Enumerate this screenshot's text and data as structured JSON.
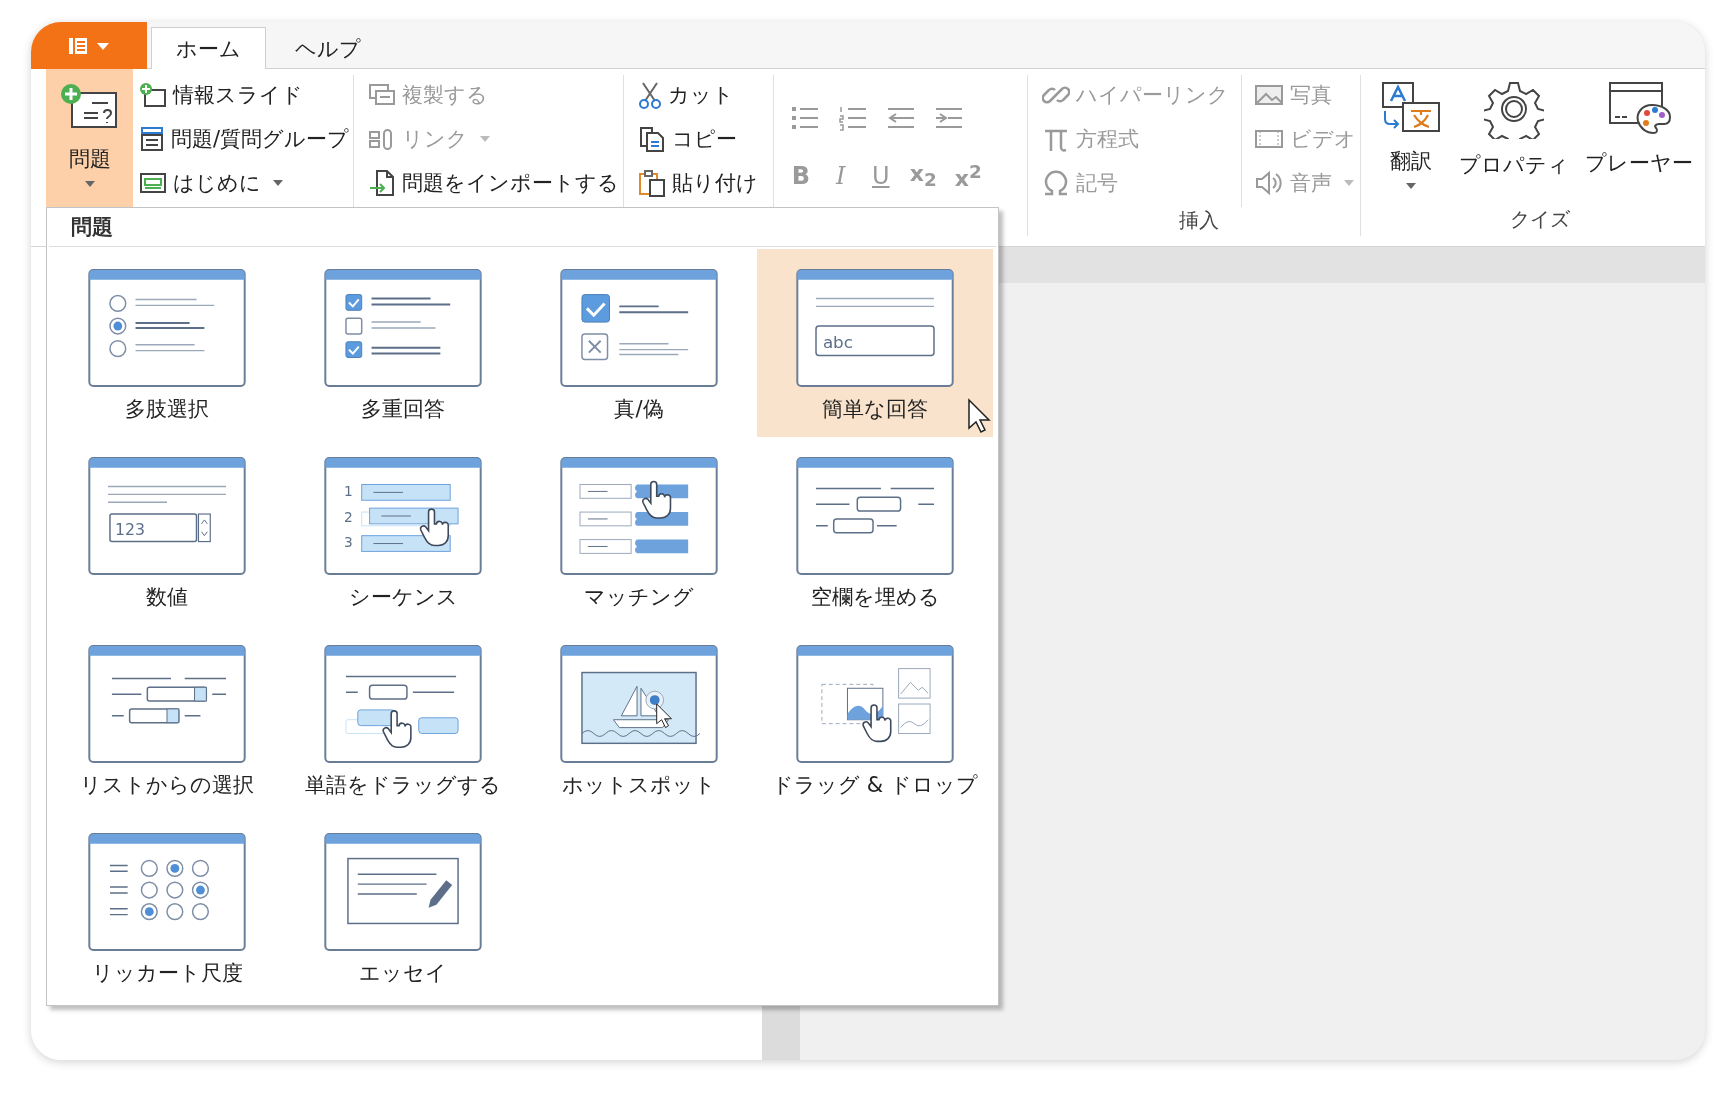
{
  "tabs": [
    {
      "label": "ホーム",
      "selected": true
    },
    {
      "label": "ヘルプ",
      "selected": false
    }
  ],
  "ribbon": {
    "groups": [
      {
        "kind": "columns",
        "columns": [
          [
            {
              "kind": "large",
              "label": "問題",
              "pressed": true,
              "dropdown": true
            }
          ],
          [
            {
              "kind": "small",
              "label": "情報スライド",
              "dropdown": false,
              "disabled": false
            },
            {
              "kind": "small",
              "label": "問題/質問グループ",
              "dropdown": false,
              "disabled": false
            },
            {
              "kind": "small",
              "label": "はじめに",
              "dropdown": true,
              "disabled": false
            }
          ]
        ]
      },
      {
        "kind": "columns",
        "columns": [
          [
            {
              "kind": "small",
              "label": "複製する",
              "dropdown": false,
              "disabled": true
            },
            {
              "kind": "small",
              "label": "リンク",
              "dropdown": true,
              "disabled": true
            },
            {
              "kind": "small",
              "label": "問題をインポートする",
              "dropdown": false,
              "disabled": false
            }
          ]
        ]
      },
      {
        "kind": "columns",
        "columns": [
          [
            {
              "kind": "small",
              "label": "カット",
              "dropdown": false,
              "disabled": false
            },
            {
              "kind": "small",
              "label": "コピー",
              "dropdown": false,
              "disabled": false
            },
            {
              "kind": "small",
              "label": "貼り付け",
              "dropdown": false,
              "disabled": false
            }
          ]
        ]
      },
      {
        "kind": "rows",
        "rows": [
          [
            {
              "kind": "tool",
              "disabled": true
            },
            {
              "kind": "tool",
              "disabled": true
            },
            {
              "kind": "tool",
              "disabled": true
            },
            {
              "kind": "tool",
              "disabled": true
            }
          ],
          [
            {
              "kind": "format",
              "label": "B",
              "disabled": true
            },
            {
              "kind": "format",
              "label": "I",
              "disabled": true
            },
            {
              "kind": "format",
              "label": "U",
              "disabled": true
            },
            {
              "kind": "format",
              "label": "x$_{2}$",
              "disabled": true
            },
            {
              "kind": "format",
              "label": "x$^{2}$",
              "disabled": true
            }
          ]
        ]
      },
      {
        "kind": "columns",
        "label": "挿入",
        "columns": [
          [
            {
              "kind": "small",
              "label": "ハイパーリンク",
              "dropdown": false,
              "disabled": true
            },
            {
              "kind": "small",
              "label": "方程式",
              "dropdown": false,
              "disabled": true
            },
            {
              "kind": "small",
              "label": "記号",
              "dropdown": false,
              "disabled": true
            }
          ],
          [
            {
              "kind": "small",
              "label": "写真",
              "dropdown": false,
              "disabled": true
            },
            {
              "kind": "small",
              "label": "ビデオ",
              "dropdown": false,
              "disabled": true
            },
            {
              "kind": "small",
              "label": "音声",
              "dropdown": true,
              "disabled": true
            }
          ]
        ]
      },
      {
        "kind": "columns",
        "label": "クイズ",
        "columns": [
          [
            {
              "kind": "large",
              "label": "翻訳",
              "pressed": false,
              "dropdown": true
            }
          ],
          [
            {
              "kind": "large",
              "label": "プロパティ",
              "pressed": false,
              "dropdown": false
            }
          ],
          [
            {
              "kind": "large",
              "label": "プレーヤー",
              "pressed": false,
              "dropdown": false
            }
          ]
        ]
      }
    ]
  },
  "gallery": {
    "title": "問題",
    "items": [
      {
        "label": "多肢選択",
        "selected": false
      },
      {
        "label": "多重回答",
        "selected": false
      },
      {
        "label": "真/偽",
        "selected": false
      },
      {
        "label": "簡単な回答",
        "selected": true,
        "icon_texts": [
          "abc"
        ]
      },
      {
        "label": "数値",
        "selected": false,
        "icon_texts": [
          "123"
        ]
      },
      {
        "label": "シーケンス",
        "selected": false,
        "icon_texts": [
          "1",
          "2",
          "3"
        ]
      },
      {
        "label": "マッチング",
        "selected": false
      },
      {
        "label": "空欄を埋める",
        "selected": false
      },
      {
        "label": "リストからの選択",
        "selected": false
      },
      {
        "label": "単語をドラッグする",
        "selected": false
      },
      {
        "label": "ホットスポット",
        "selected": false
      },
      {
        "label": "ドラッグ & ドロップ",
        "selected": false
      },
      {
        "label": "リッカート尺度",
        "selected": false
      },
      {
        "label": "エッセイ",
        "selected": false
      }
    ]
  }
}
